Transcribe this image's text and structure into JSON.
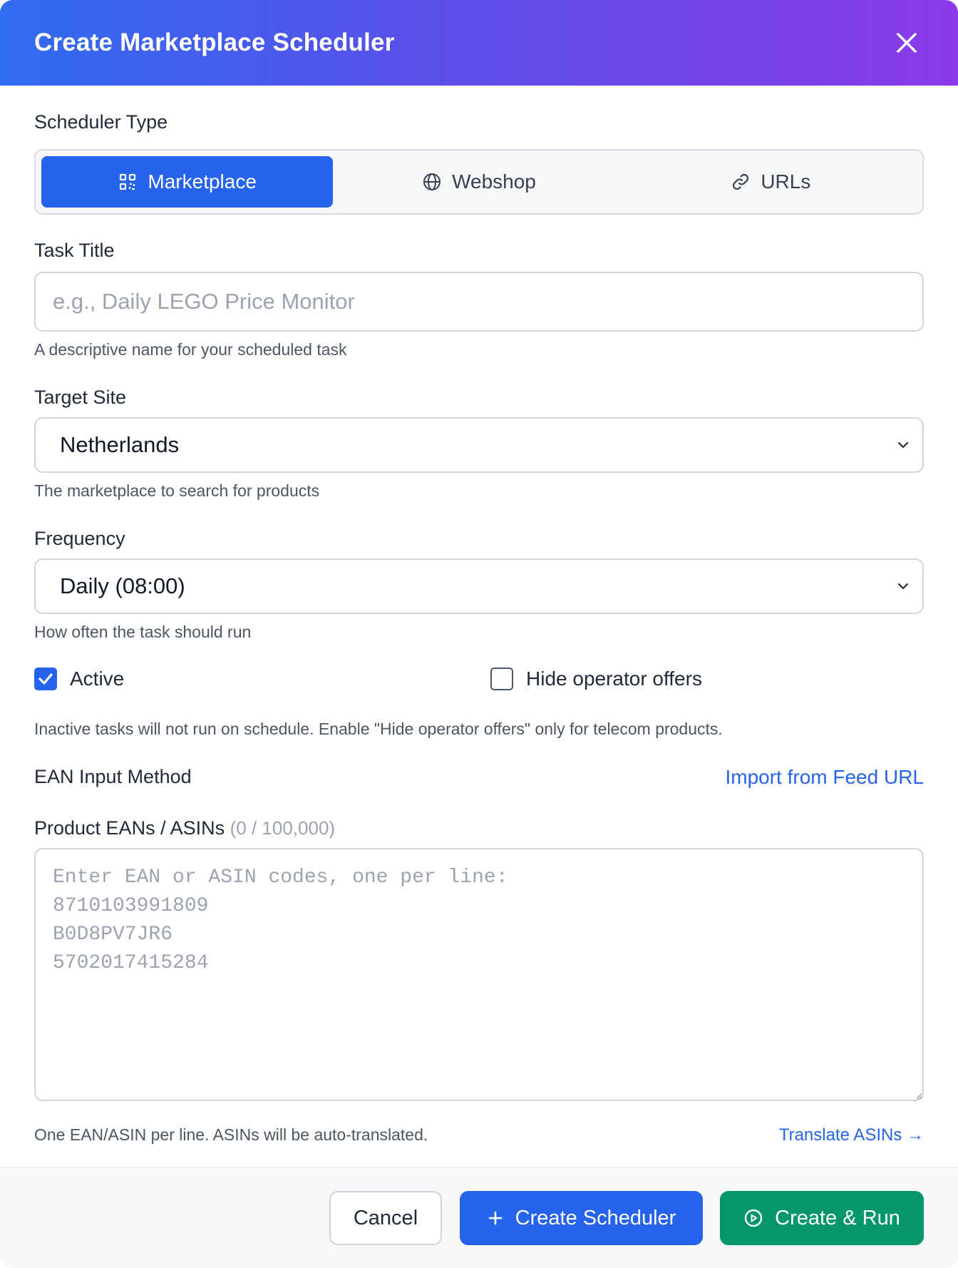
{
  "dialog": {
    "title": "Create Marketplace Scheduler"
  },
  "scheduler_type": {
    "label": "Scheduler Type",
    "options": [
      {
        "label": "Marketplace",
        "icon": "qr-grid-icon",
        "active": true
      },
      {
        "label": "Webshop",
        "icon": "globe-icon",
        "active": false
      },
      {
        "label": "URLs",
        "icon": "link-icon",
        "active": false
      }
    ]
  },
  "task_title": {
    "label": "Task Title",
    "placeholder": "e.g., Daily LEGO Price Monitor",
    "value": "",
    "hint": "A descriptive name for your scheduled task"
  },
  "target_site": {
    "label": "Target Site",
    "value": "Netherlands",
    "hint": "The marketplace to search for products"
  },
  "frequency": {
    "label": "Frequency",
    "value": "Daily (08:00)",
    "hint": "How often the task should run"
  },
  "options": {
    "active_label": "Active",
    "active_checked": true,
    "hide_operator_label": "Hide operator offers",
    "hide_operator_checked": false,
    "hint": "Inactive tasks will not run on schedule. Enable \"Hide operator offers\" only for telecom products."
  },
  "ean_input": {
    "method_label": "EAN Input Method",
    "import_link": "Import from Feed URL",
    "products_label": "Product EANs / ASINs",
    "count": "(0 / 100,000)",
    "placeholder": "Enter EAN or ASIN codes, one per line:\n8710103991809\nB0D8PV7JR6\n5702017415284",
    "hint": "One EAN/ASIN per line. ASINs will be auto-translated.",
    "translate_link": "Translate ASINs →"
  },
  "footer": {
    "cancel": "Cancel",
    "create": "Create Scheduler",
    "create_run": "Create & Run"
  },
  "colors": {
    "primary": "#2563eb",
    "success": "#059669",
    "header_gradient_start": "#2f6cf0",
    "header_gradient_end": "#8a3ae8"
  }
}
